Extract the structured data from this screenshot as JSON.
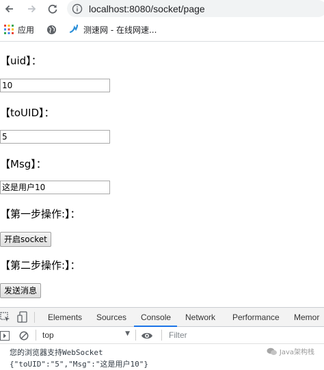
{
  "browser": {
    "url": "localhost:8080/socket/page",
    "bookmarks": [
      {
        "label": "应用",
        "icon": "apps-grid-icon"
      },
      {
        "label": "",
        "icon": "globe-icon"
      },
      {
        "label": "测速网 - 在线网速...",
        "icon": "speedtest-icon"
      }
    ]
  },
  "form": {
    "uid_label": "【uid】：",
    "uid_value": "10",
    "touid_label": "【toUID】：",
    "touid_value": "5",
    "msg_label": "【Msg】：",
    "msg_value": "这是用户10",
    "step1_label": "【第一步操作:】：",
    "step1_button": "开启socket",
    "step2_label": "【第二步操作:】：",
    "step2_button": "发送消息"
  },
  "devtools": {
    "tabs": [
      "Elements",
      "Sources",
      "Console",
      "Network",
      "Performance",
      "Memor"
    ],
    "active_tab": "Console",
    "context": "top",
    "filter_placeholder": "Filter",
    "console_lines": [
      "您的浏览器支持WebSocket",
      "{\"toUID\":\"5\",\"Msg\":\"这是用户10\"}"
    ],
    "watermark": "Java架构栈"
  }
}
